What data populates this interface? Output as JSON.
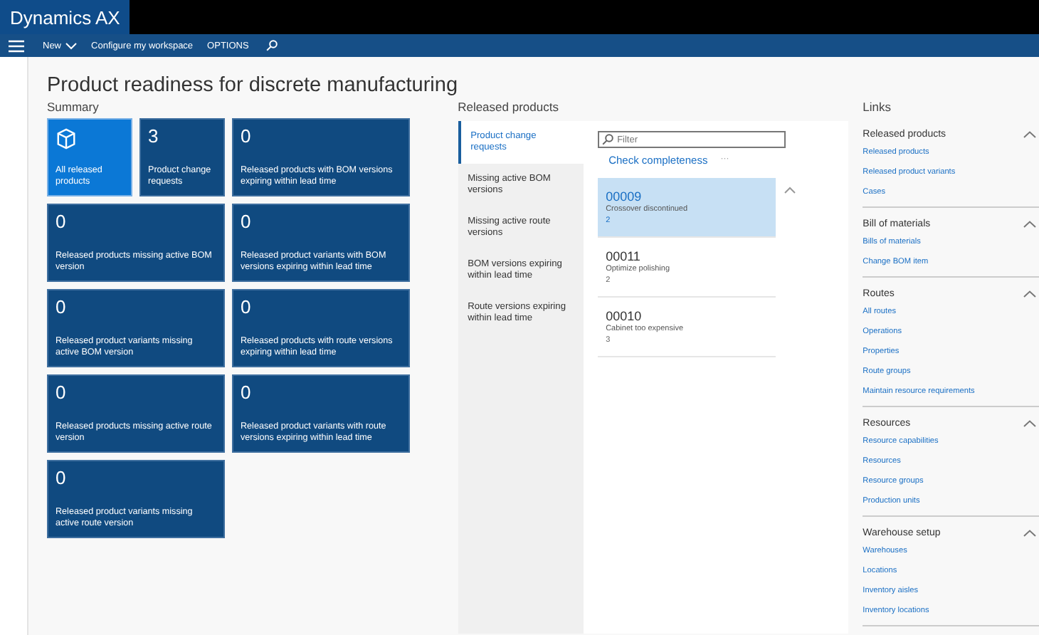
{
  "app": {
    "title": "Dynamics AX"
  },
  "command_bar": {
    "items": [
      {
        "label": "New",
        "kind": "dropdown"
      },
      {
        "label": "Configure my workspace",
        "kind": "plain"
      },
      {
        "label": "OPTIONS",
        "kind": "plain"
      }
    ]
  },
  "page": {
    "title": "Product readiness for discrete manufacturing"
  },
  "summary": {
    "heading": "Summary",
    "tiles": [
      {
        "kind": "icon",
        "label": "All released products",
        "selected": true
      },
      {
        "kind": "count",
        "count": "3",
        "label": "Product change requests",
        "selected": false
      },
      {
        "kind": "count",
        "count": "0",
        "label": "Released products with BOM versions expiring within lead time",
        "selected": false
      },
      {
        "kind": "count",
        "count": "0",
        "label": "Released products missing active BOM version",
        "selected": false
      },
      {
        "kind": "count",
        "count": "0",
        "label": "Released product variants with BOM versions expiring within lead time",
        "selected": false
      },
      {
        "kind": "count",
        "count": "0",
        "label": "Released product variants missing active BOM version",
        "selected": false
      },
      {
        "kind": "count",
        "count": "0",
        "label": "Released products with route versions expiring within lead time",
        "selected": false
      },
      {
        "kind": "count",
        "count": "0",
        "label": "Released products missing active route version",
        "selected": false
      },
      {
        "kind": "count",
        "count": "0",
        "label": "Released product variants with route versions expiring within lead time",
        "selected": false
      },
      {
        "kind": "count",
        "count": "0",
        "label": "Released product variants missing active route version",
        "selected": false
      }
    ]
  },
  "released_products": {
    "heading": "Released products",
    "tabs": [
      {
        "label": "Product change requests",
        "selected": true
      },
      {
        "label": "Missing active BOM versions",
        "selected": false
      },
      {
        "label": "Missing active route versions",
        "selected": false
      },
      {
        "label": "BOM versions expiring within lead time",
        "selected": false
      },
      {
        "label": "Route versions expiring within lead time",
        "selected": false
      }
    ],
    "filter": {
      "placeholder": "Filter"
    },
    "action": "Check completeness",
    "more": "···",
    "rows": [
      {
        "id": "00009",
        "description": "Crossover discontinued",
        "count": "2",
        "selected": true
      },
      {
        "id": "00011",
        "description": "Optimize polishing",
        "count": "2",
        "selected": false
      },
      {
        "id": "00010",
        "description": "Cabinet too expensive",
        "count": "3",
        "selected": false
      }
    ]
  },
  "links": {
    "heading": "Links",
    "groups": [
      {
        "title": "Released products",
        "expanded": true,
        "items": [
          "Released products",
          "Released product variants",
          "Cases"
        ]
      },
      {
        "title": "Bill of materials",
        "expanded": true,
        "items": [
          "Bills of materials",
          "Change BOM item"
        ]
      },
      {
        "title": "Routes",
        "expanded": true,
        "items": [
          "All routes",
          "Operations",
          "Properties",
          "Route groups",
          "Maintain resource requirements"
        ]
      },
      {
        "title": "Resources",
        "expanded": true,
        "items": [
          "Resource capabilities",
          "Resources",
          "Resource groups",
          "Production units"
        ]
      },
      {
        "title": "Warehouse setup",
        "expanded": true,
        "items": [
          "Warehouses",
          "Locations",
          "Inventory aisles",
          "Inventory locations"
        ]
      }
    ]
  }
}
